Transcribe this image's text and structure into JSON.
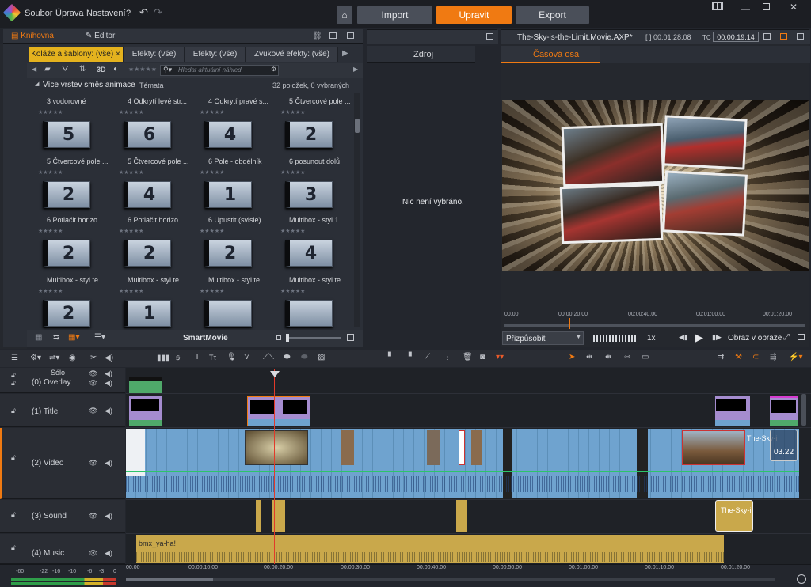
{
  "menu": {
    "file": "Soubor",
    "edit": "Úprava",
    "settings": "Nastavení"
  },
  "modes": {
    "import": "Import",
    "edit": "Upravit",
    "export": "Export"
  },
  "library": {
    "tab_library": "Knihovna",
    "tab_editor": "Editor",
    "subtabs": [
      "Koláže a šablony: (vše)",
      "Efekty: (vše)",
      "Efekty: (vše)",
      "Zvukové efekty: (vše)"
    ],
    "view_3d": "3D",
    "search_placeholder": "Hledat aktuální náhled",
    "section_title": "Více vrstev směs animace",
    "section_topics": "Témata",
    "section_count": "32 položek, 0 vybraných",
    "items": [
      {
        "label": "3 vodorovné",
        "glyph": "5"
      },
      {
        "label": "4 Odkrytí levé str...",
        "glyph": "6"
      },
      {
        "label": "4 Odkrytí pravé s...",
        "glyph": "4"
      },
      {
        "label": "5 Čtvercové pole ...",
        "glyph": "2"
      },
      {
        "label": "5 Čtvercové pole ...",
        "glyph": "2"
      },
      {
        "label": "5 Čtvercové pole ...",
        "glyph": "4"
      },
      {
        "label": "6 Pole - obdélník",
        "glyph": "1"
      },
      {
        "label": "6 posunout dolů",
        "glyph": "3"
      },
      {
        "label": "6 Potlačit horizo...",
        "glyph": "2"
      },
      {
        "label": "6 Potlačit horizo...",
        "glyph": "2"
      },
      {
        "label": "6 Upustit (svisle)",
        "glyph": "2"
      },
      {
        "label": "Multibox - styl 1",
        "glyph": "4"
      },
      {
        "label": "Multibox - styl te...",
        "glyph": "2"
      },
      {
        "label": "Multibox - styl te...",
        "glyph": "1"
      },
      {
        "label": "Multibox - styl te...",
        "glyph": ""
      },
      {
        "label": "Multibox - styl te...",
        "glyph": ""
      }
    ],
    "smartmovie": "SmartMovie"
  },
  "source": {
    "tab": "Zdroj",
    "empty": "Nic není vybráno."
  },
  "player": {
    "file": "The-Sky-is-the-Limit.Movie.AXP*",
    "duration": "00:01:28.08",
    "tc_label": "TC",
    "tc": "00:00:19.14",
    "tab": "Časová osa",
    "ticks": [
      "00.00",
      "00:00:20.00",
      "00:00:40.00",
      "00:01:00.00",
      "00:01:20.00"
    ],
    "fit": "Přizpůsobit",
    "speed": "1x",
    "fit_screen": "Obraz v obraze"
  },
  "timeline": {
    "solo": "Sólo",
    "tracks": [
      "(0) Overlay",
      "(1) Title",
      "(2) Video",
      "(3) Sound",
      "(4) Music"
    ],
    "clip_sky": "The-Sky-i",
    "clip_sky2": "The-Sky-i",
    "clip_time": "03.22",
    "clip_music": "bmx_ya-ha!",
    "ruler": [
      "00.00",
      "00:00:10.00",
      "00:00:20.00",
      "00:00:30.00",
      "00:00:40.00",
      "00:00:50.00",
      "00:01:00.00",
      "00:01:10.00",
      "00:01:20.00"
    ],
    "meter": [
      "-60",
      "-22",
      "-16",
      "-10",
      "-6",
      "-3",
      "0"
    ]
  },
  "colors": {
    "accent": "#f07a12",
    "subtab": "#e4b21e",
    "video_clip": "#6fa3cf",
    "sound_clip": "#c9a84b",
    "title_clip": "#a58ccf"
  }
}
